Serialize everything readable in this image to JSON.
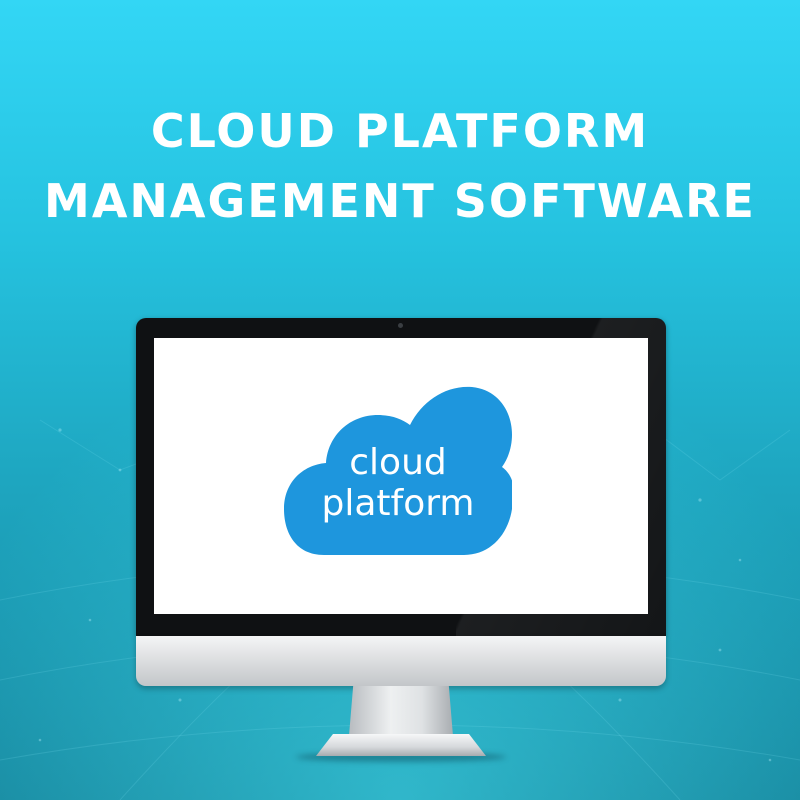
{
  "headline": {
    "line1": "CLOUD PLATFORM",
    "line2": "MANAGEMENT SOFTWARE"
  },
  "logo": {
    "line1": "cloud",
    "line2": "platform",
    "icon": "cloud-icon"
  },
  "colors": {
    "background_top": "#33d6f5",
    "background_bottom": "#17889f",
    "cloud_blue": "#1e96dd",
    "screen": "#ffffff",
    "bezel": "#0f1113"
  }
}
